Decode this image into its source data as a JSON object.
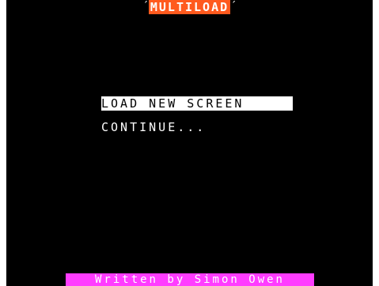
{
  "app": {
    "title": "MULTILOAD",
    "title_bracket_left": "´",
    "title_bracket_right": "´"
  },
  "menu": {
    "items": [
      {
        "label": "LOAD NEW SCREEN",
        "selected": true
      },
      {
        "label": "CONTINUE...",
        "selected": false
      }
    ]
  },
  "footer": {
    "credit": "Written by Simon Owen"
  },
  "colors": {
    "background": "#000000",
    "title_bg": "#ff5a1e",
    "footer_bg": "#ff3cff",
    "text": "#ffffff"
  }
}
